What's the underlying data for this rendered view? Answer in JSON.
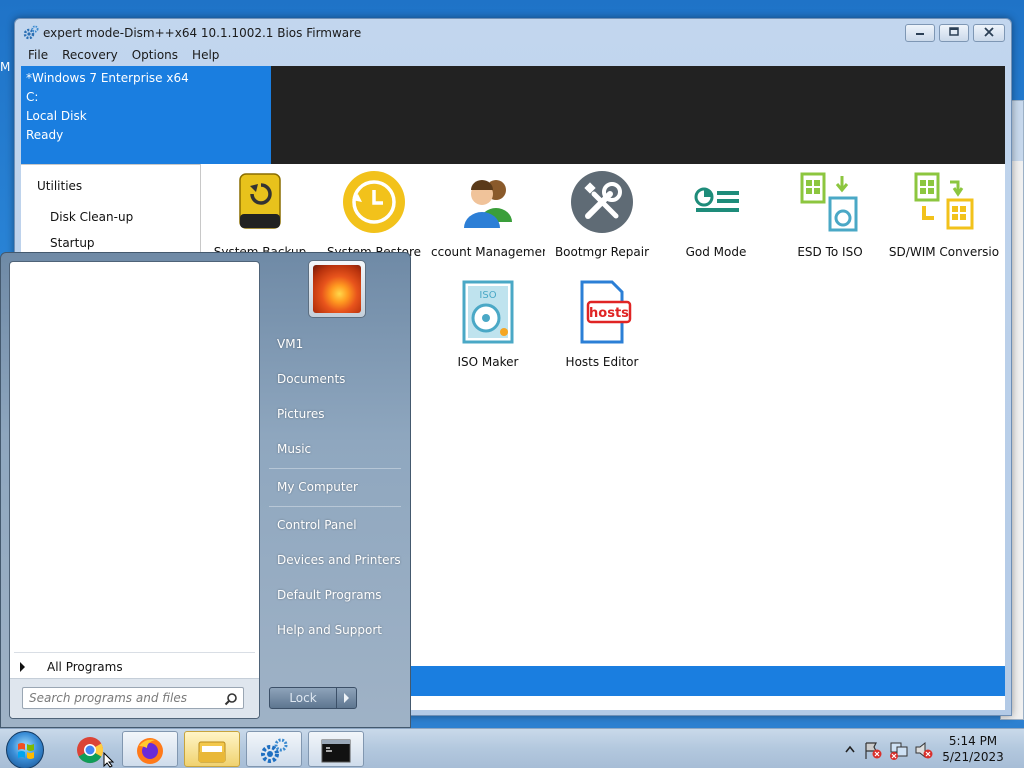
{
  "desktop": {
    "edge_letter": "M"
  },
  "window": {
    "title": "expert mode-Dism++x64 10.1.1002.1 Bios Firmware",
    "menu": [
      "File",
      "Recovery",
      "Options",
      "Help"
    ]
  },
  "system_info": {
    "os": "*Windows 7 Enterprise x64",
    "drive": "C:",
    "disk_type": "Local Disk",
    "status": "Ready"
  },
  "sidebar": {
    "heading": "Utilities",
    "items": [
      "Disk Clean-up",
      "Startup"
    ]
  },
  "tools": [
    {
      "label": "System Backup",
      "icon": "system-backup-icon"
    },
    {
      "label": "System Restore",
      "icon": "system-restore-icon"
    },
    {
      "label": "ccount Managemer",
      "icon": "account-management-icon"
    },
    {
      "label": "Bootmgr Repair",
      "icon": "bootmgr-repair-icon"
    },
    {
      "label": "God Mode",
      "icon": "god-mode-icon"
    },
    {
      "label": "ESD To ISO",
      "icon": "esd-to-iso-icon"
    },
    {
      "label": "SD/WIM Conversio",
      "icon": "esd-wim-conversion-icon"
    },
    {
      "label": "ISO Maker",
      "icon": "iso-maker-icon"
    },
    {
      "label": "Hosts Editor",
      "icon": "hosts-editor-icon",
      "icon_text": "hosts"
    }
  ],
  "start_menu": {
    "right_items": [
      "VM1",
      "Documents",
      "Pictures",
      "Music",
      "My Computer",
      "Control Panel",
      "Devices and Printers",
      "Default Programs",
      "Help and Support"
    ],
    "all_programs": "All Programs",
    "search_placeholder": "Search programs and files",
    "lock_label": "Lock"
  },
  "taskbar": {
    "time": "5:14 PM",
    "date": "5/21/2023"
  },
  "colors": {
    "accent_blue": "#1a7ee0",
    "dark_panel": "#222222",
    "restore_yellow": "#f2c21b",
    "god_mode_teal": "#1e8c7a",
    "iso_teal": "#4aa8c6",
    "hosts_red": "#e02424"
  }
}
